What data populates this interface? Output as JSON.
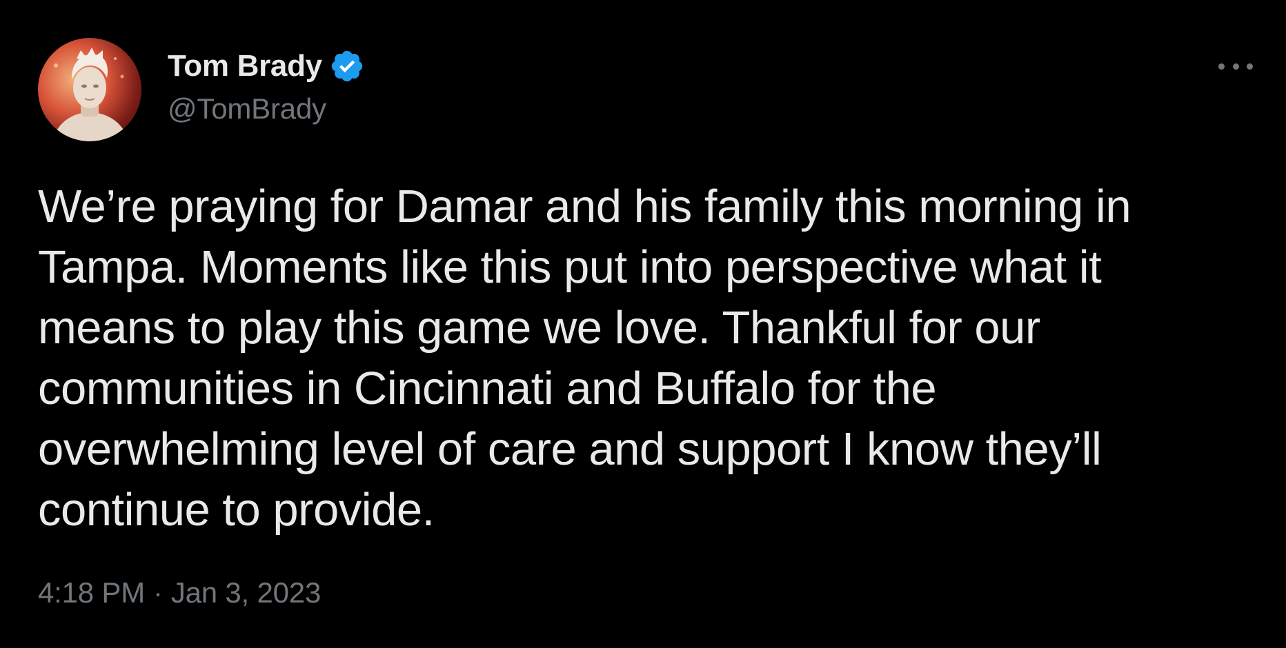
{
  "author": {
    "display_name": "Tom Brady",
    "handle": "@TomBrady",
    "verified": true,
    "verified_color": "#1d9bf0",
    "avatar_icon": "profile-avatar"
  },
  "menu": {
    "icon": "more-options-icon"
  },
  "tweet": {
    "lines": [
      "We’re praying for Damar and his family this morning in",
      "Tampa. Moments like this put into perspective what it",
      "means to play this game we love. Thankful for our",
      "communities in Cincinnati and Buffalo for the",
      "overwhelming level of care and support I know they’ll",
      "continue to provide."
    ]
  },
  "meta": {
    "time": "4:18 PM",
    "separator": "·",
    "date": "Jan 3, 2023"
  },
  "colors": {
    "background": "#000000",
    "primary_text": "#e7e9ea",
    "secondary_text": "#71767b"
  }
}
